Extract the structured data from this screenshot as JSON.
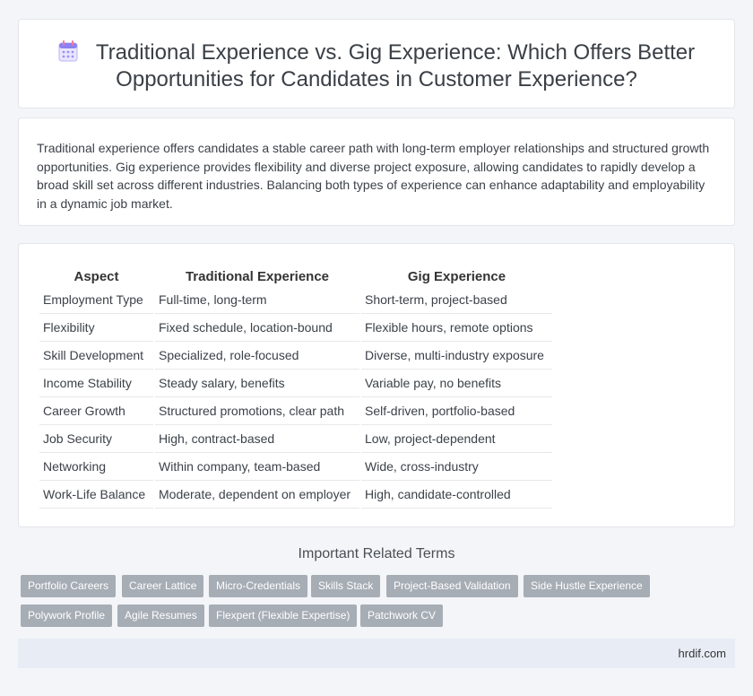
{
  "header": {
    "icon": "calendar-icon",
    "title": "Traditional Experience vs. Gig Experience: Which Offers Better Opportunities for Candidates in Customer Experience?"
  },
  "intro": "Traditional experience offers candidates a stable career path with long-term employer relationships and structured growth opportunities. Gig experience provides flexibility and diverse project exposure, allowing candidates to rapidly develop a broad skill set across different industries. Balancing both types of experience can enhance adaptability and employability in a dynamic job market.",
  "table": {
    "headers": [
      "Aspect",
      "Traditional Experience",
      "Gig Experience"
    ],
    "rows": [
      [
        "Employment Type",
        "Full-time, long-term",
        "Short-term, project-based"
      ],
      [
        "Flexibility",
        "Fixed schedule, location-bound",
        "Flexible hours, remote options"
      ],
      [
        "Skill Development",
        "Specialized, role-focused",
        "Diverse, multi-industry exposure"
      ],
      [
        "Income Stability",
        "Steady salary, benefits",
        "Variable pay, no benefits"
      ],
      [
        "Career Growth",
        "Structured promotions, clear path",
        "Self-driven, portfolio-based"
      ],
      [
        "Job Security",
        "High, contract-based",
        "Low, project-dependent"
      ],
      [
        "Networking",
        "Within company, team-based",
        "Wide, cross-industry"
      ],
      [
        "Work-Life Balance",
        "Moderate, dependent on employer",
        "High, candidate-controlled"
      ]
    ]
  },
  "related": {
    "title": "Important Related Terms",
    "tags": [
      "Portfolio Careers",
      "Career Lattice",
      "Micro-Credentials",
      "Skills Stack",
      "Project-Based Validation",
      "Side Hustle Experience",
      "Polywork Profile",
      "Agile Resumes",
      "Flexpert (Flexible Expertise)",
      "Patchwork CV"
    ]
  },
  "footer": {
    "site": "hrdif.com"
  },
  "colors": {
    "tag_bg": "#a7adb5",
    "footer_bg": "#e8edf5",
    "icon_accent": "#7b6cf0"
  }
}
